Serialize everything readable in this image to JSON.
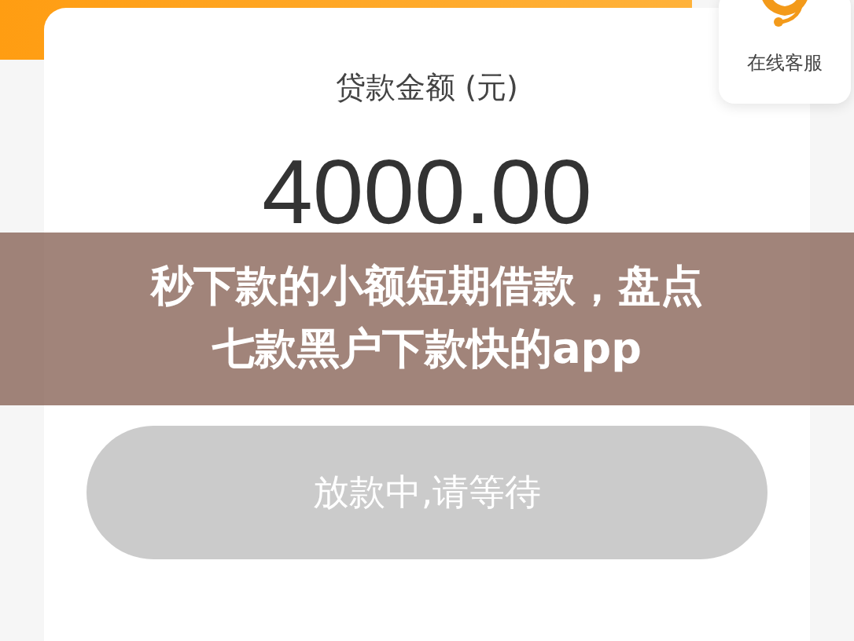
{
  "loan_card": {
    "label": "贷款金额 (元)",
    "amount": "4000.00",
    "button": {
      "label": "放款中,请等待",
      "disabled": true
    }
  },
  "service_widget": {
    "label": "在线客服"
  },
  "overlay_title": {
    "lines": [
      "秒下款的小额短期借款，盘点",
      "七款黑户下款快的app"
    ]
  }
}
